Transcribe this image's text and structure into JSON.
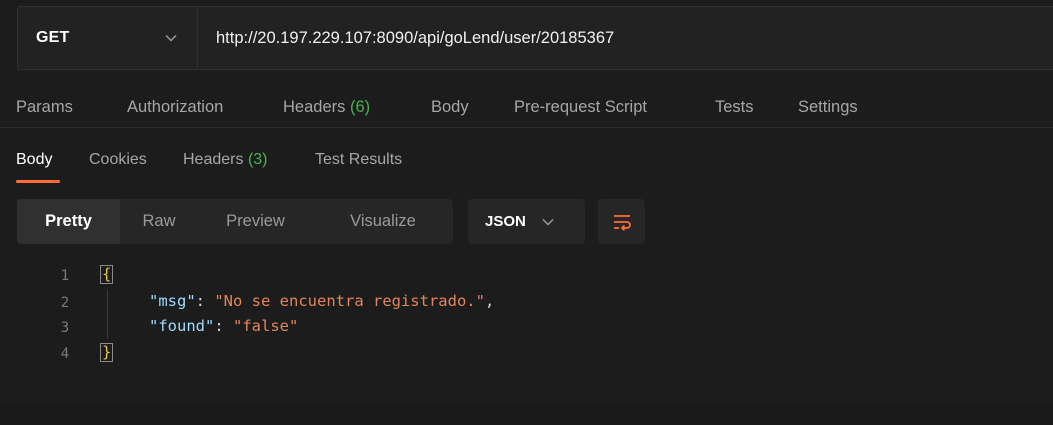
{
  "request": {
    "method": "GET",
    "url": "http://20.197.229.107:8090/api/goLend/user/20185367"
  },
  "request_tabs": [
    {
      "label": "Params"
    },
    {
      "label": "Authorization"
    },
    {
      "label": "Headers",
      "count": "(6)"
    },
    {
      "label": "Body"
    },
    {
      "label": "Pre-request Script"
    },
    {
      "label": "Tests"
    },
    {
      "label": "Settings"
    }
  ],
  "response_tabs": [
    {
      "label": "Body",
      "active": true
    },
    {
      "label": "Cookies"
    },
    {
      "label": "Headers",
      "count": "(3)"
    },
    {
      "label": "Test Results"
    }
  ],
  "view_modes": [
    "Pretty",
    "Raw",
    "Preview",
    "Visualize"
  ],
  "format": "JSON",
  "code": {
    "line_numbers": [
      "1",
      "2",
      "3",
      "4"
    ],
    "open_brace": "{",
    "close_brace": "}",
    "entries": [
      {
        "key": "\"msg\"",
        "colon": ": ",
        "value": "\"No se encuentra registrado.\"",
        "comma": ","
      },
      {
        "key": "\"found\"",
        "colon": ": ",
        "value": "\"false\"",
        "comma": ""
      }
    ]
  },
  "colors": {
    "accent": "#ff6c37",
    "count": "#49b14f",
    "json_key": "#9cdcfe",
    "json_string": "#e3845b",
    "background": "#1c1c1c"
  },
  "icons": {
    "method_dropdown": "chevron-down-icon",
    "format_dropdown": "chevron-down-icon",
    "wrap": "wrap-lines-icon"
  }
}
